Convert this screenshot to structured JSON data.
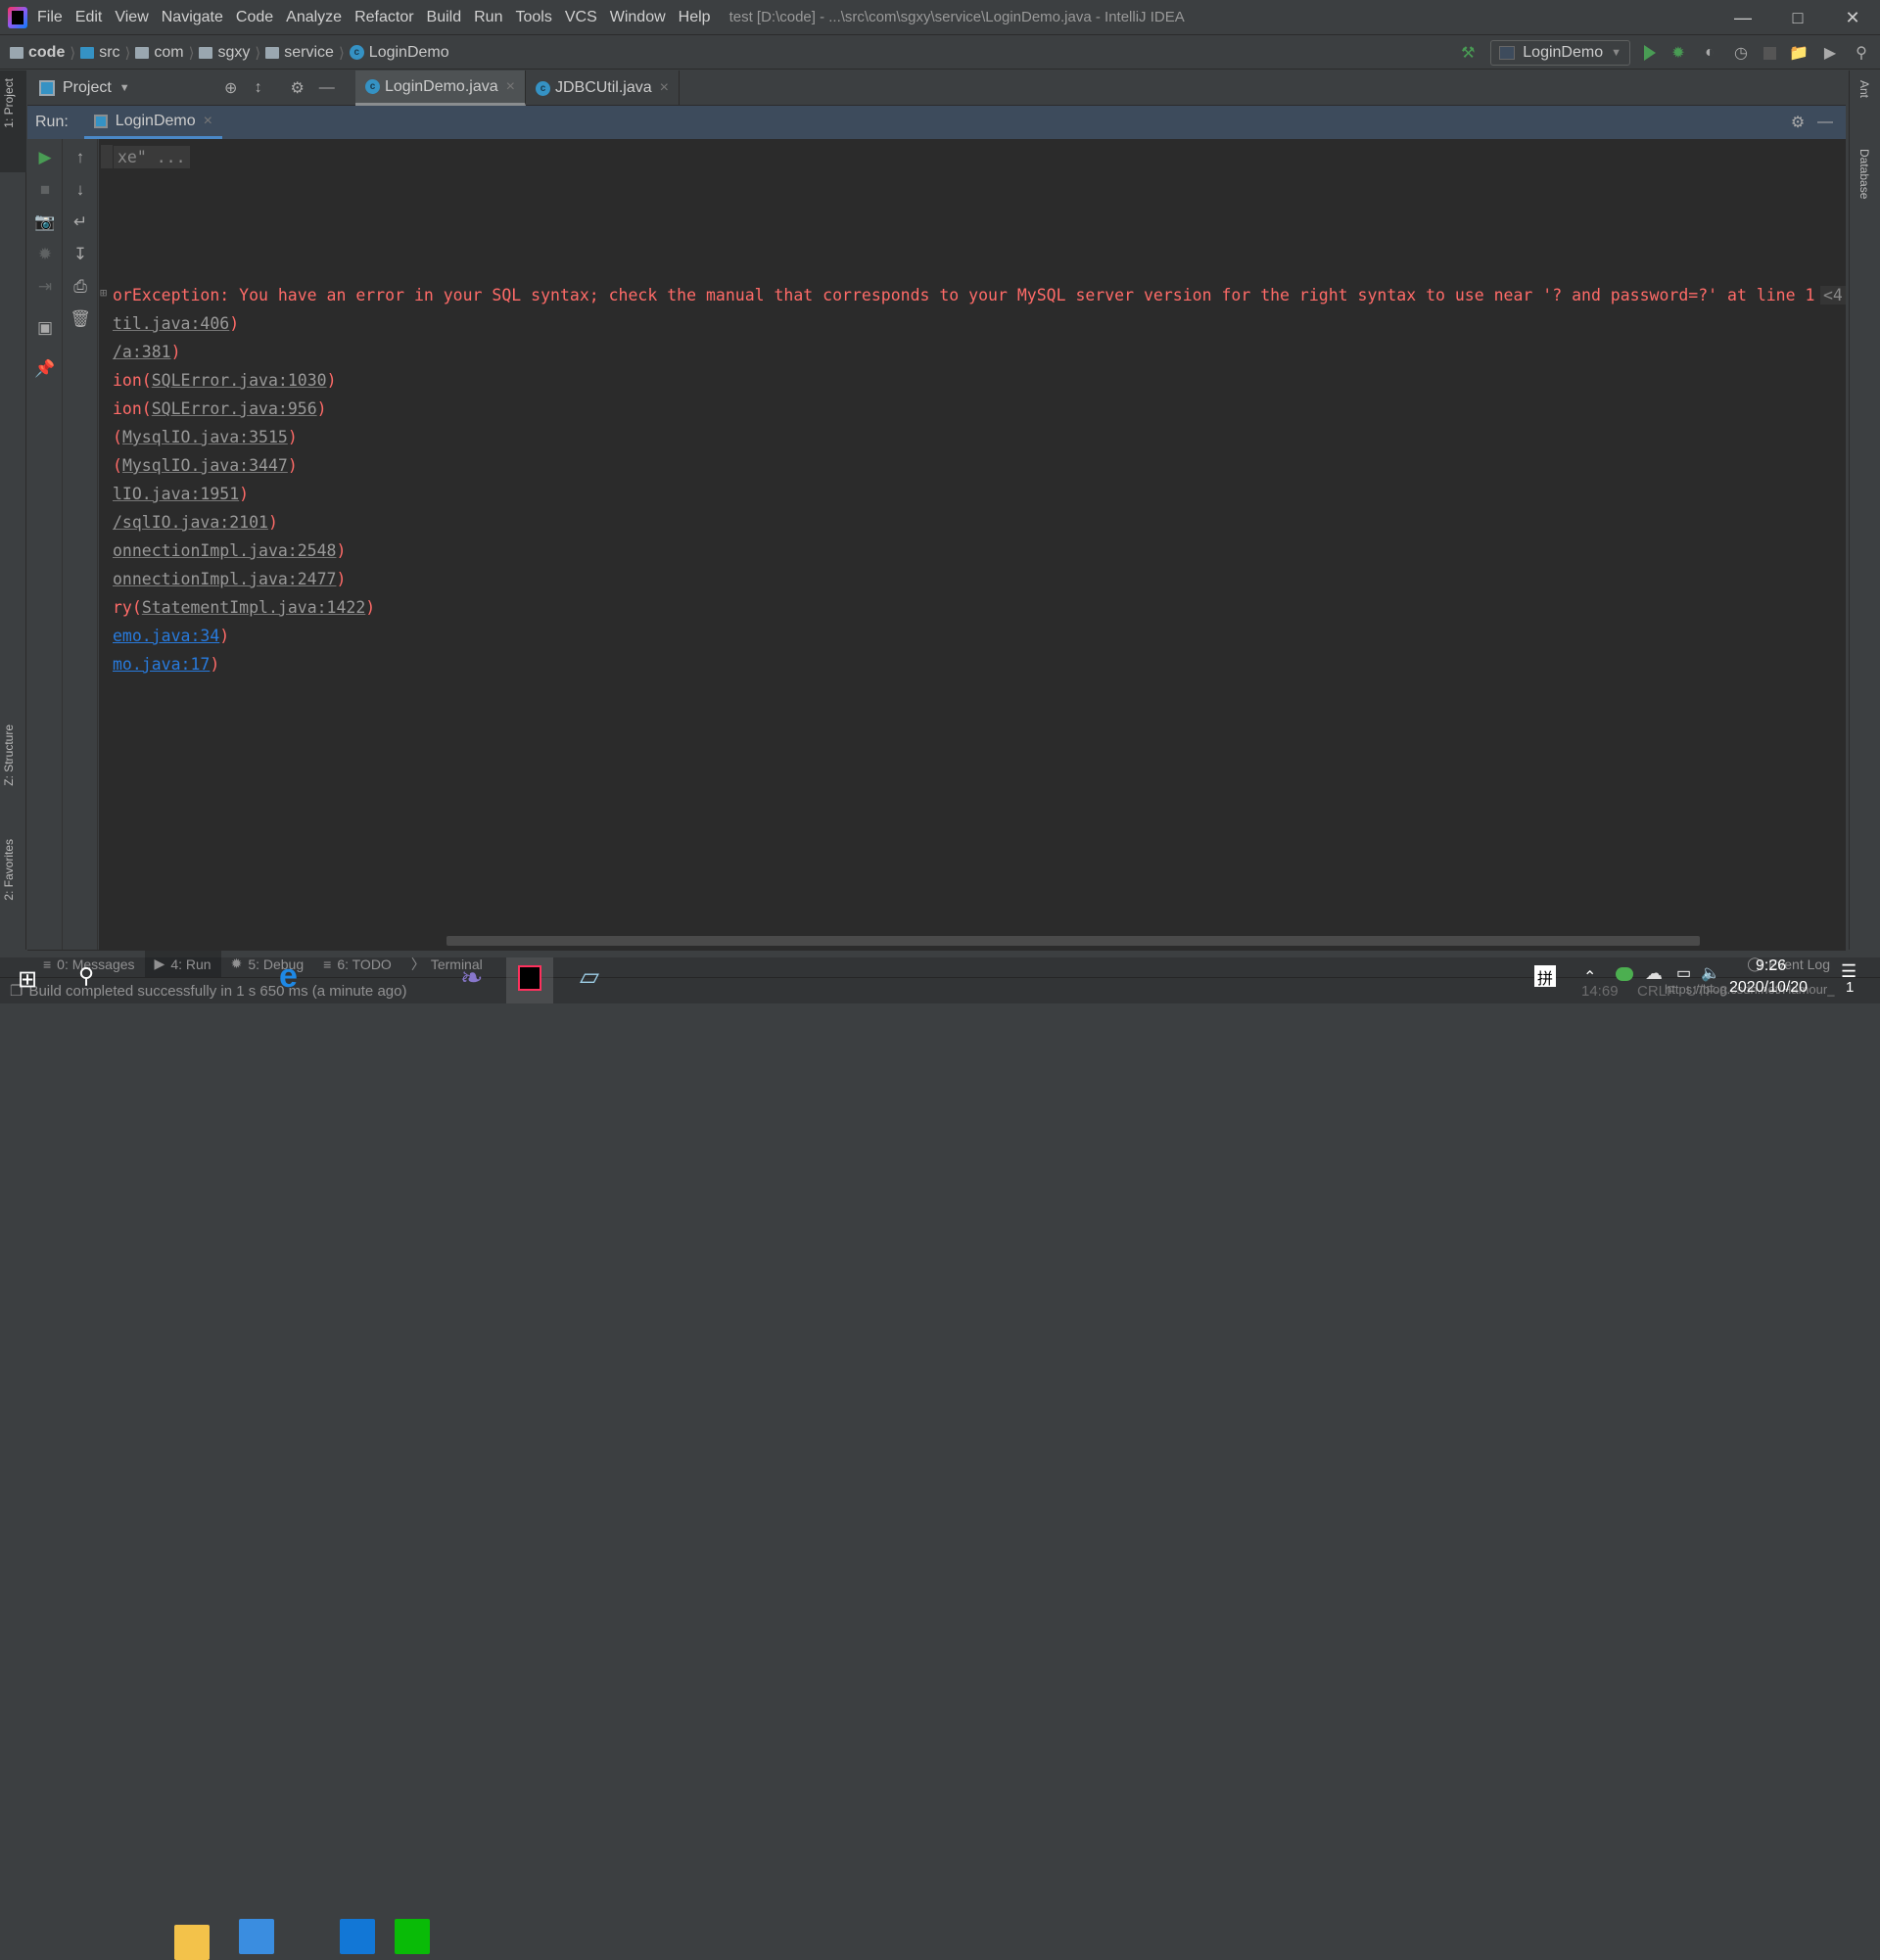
{
  "window": {
    "title": "test [D:\\code] - ...\\src\\com\\sgxy\\service\\LoginDemo.java - IntelliJ IDEA"
  },
  "menu": [
    "File",
    "Edit",
    "View",
    "Navigate",
    "Code",
    "Analyze",
    "Refactor",
    "Build",
    "Run",
    "Tools",
    "VCS",
    "Window",
    "Help"
  ],
  "breadcrumb": [
    "code",
    "src",
    "com",
    "sgxy",
    "service",
    "LoginDemo"
  ],
  "toolbar": {
    "run_config": "LoginDemo"
  },
  "project_panel": {
    "label": "Project"
  },
  "editor_tabs": [
    {
      "label": "LoginDemo.java",
      "active": true
    },
    {
      "label": "JDBCUtil.java",
      "active": false
    }
  ],
  "left_strip": {
    "project": "1: Project",
    "structure": "Z: Structure",
    "favorites": "2: Favorites"
  },
  "right_strip": {
    "ant": "Ant",
    "database": "Database"
  },
  "run": {
    "label": "Run:",
    "tab": "LoginDemo"
  },
  "console": {
    "folded": "xe\" ...",
    "error_line": "orException: You have an error in your SQL syntax; check the manual that corresponds to your MySQL server version for the right syntax to use near '? and password=?' at line 1",
    "overflow": "<4",
    "trace": [
      {
        "prefix": "",
        "link": "til.java:406",
        "style": "gray"
      },
      {
        "prefix": "",
        "link": "/a:381",
        "style": "gray"
      },
      {
        "prefix": "ion(",
        "link": "SQLError.java:1030",
        "style": "gray"
      },
      {
        "prefix": "ion(",
        "link": "SQLError.java:956",
        "style": "gray"
      },
      {
        "prefix": "(",
        "link": "MysqlIO.java:3515",
        "style": "gray"
      },
      {
        "prefix": "(",
        "link": "MysqlIO.java:3447",
        "style": "gray"
      },
      {
        "prefix": "",
        "link": "lIO.java:1951",
        "style": "gray"
      },
      {
        "prefix": "",
        "link": "/sqlIO.java:2101",
        "style": "gray"
      },
      {
        "prefix": "",
        "link": "onnectionImpl.java:2548",
        "style": "gray"
      },
      {
        "prefix": "",
        "link": "onnectionImpl.java:2477",
        "style": "gray"
      },
      {
        "prefix": "ry(",
        "link": "StatementImpl.java:1422",
        "style": "gray"
      },
      {
        "prefix": "",
        "link": "emo.java:34",
        "style": "blue"
      },
      {
        "prefix": "",
        "link": "mo.java:17",
        "style": "blue"
      }
    ]
  },
  "bottom_tabs": [
    {
      "label": "0: Messages",
      "active": false
    },
    {
      "label": "4: Run",
      "active": true
    },
    {
      "label": "5: Debug",
      "active": false
    },
    {
      "label": "6: TODO",
      "active": false
    },
    {
      "label": "Terminal",
      "active": false
    },
    {
      "label": "Event Log",
      "active": false
    }
  ],
  "status": {
    "message": "Build completed successfully in 1 s 650 ms (a minute ago)",
    "position": "14:69",
    "line_sep": "CRLF",
    "encoding": "UTF-8",
    "watermark": "https://blog.csdn.net/Hamour_"
  },
  "taskbar": {
    "ime": "拼",
    "time": "9:26",
    "date": "2020/10/20",
    "notif_count": "1"
  }
}
